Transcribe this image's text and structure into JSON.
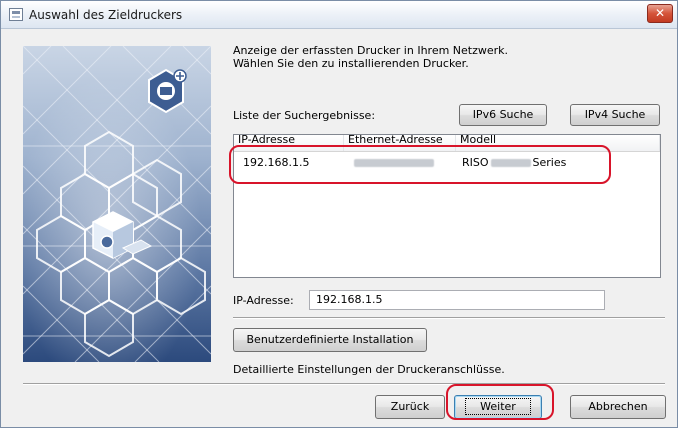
{
  "window": {
    "title": "Auswahl des Zieldruckers",
    "close_glyph": "✕"
  },
  "instructions": {
    "line1": "Anzeige der erfassten Drucker in Ihrem Netzwerk.",
    "line2": "Wählen Sie den zu installierenden Drucker."
  },
  "search": {
    "results_label": "Liste der Suchergebnisse:",
    "ipv6_button": "IPv6 Suche",
    "ipv4_button": "IPv4 Suche"
  },
  "table": {
    "columns": [
      "IP-Adresse",
      "Ethernet-Adresse",
      "Modell"
    ],
    "rows": [
      {
        "ip": "192.168.1.5",
        "model_prefix": "RISO",
        "model_suffix": "Series"
      }
    ]
  },
  "ip_field": {
    "label": "IP-Adresse:",
    "value": "192.168.1.5"
  },
  "custom": {
    "button": "Benutzerdefinierte Installation",
    "description": "Detaillierte Einstellungen der Druckeranschlüsse."
  },
  "footer": {
    "back": "Zurück",
    "next": "Weiter",
    "cancel": "Abbrechen"
  },
  "colors": {
    "highlight": "#d8142a",
    "banner_dark": "#2f4f80",
    "banner_light": "#b8c8de"
  }
}
